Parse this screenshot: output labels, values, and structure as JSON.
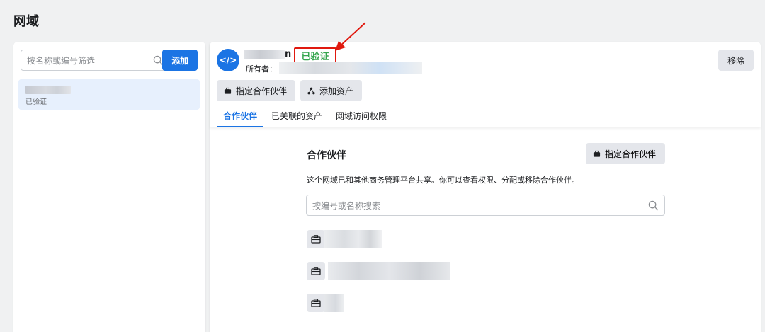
{
  "page": {
    "title": "网域"
  },
  "left": {
    "filter_placeholder": "按名称或编号筛选",
    "add_label": "添加",
    "items": [
      {
        "status": "已验证"
      }
    ]
  },
  "detail": {
    "domain_suffix": "n",
    "verified_label": "已验证",
    "owner_label": "所有者：",
    "remove_label": "移除",
    "assign_partner_label": "指定合作伙伴",
    "add_asset_label": "添加资产",
    "tabs": [
      "合作伙伴",
      "已关联的资产",
      "网域访问权限"
    ],
    "active_tab": 0
  },
  "partners": {
    "title": "合作伙伴",
    "assign_label": "指定合作伙伴",
    "description": "这个网域已和其他商务管理平台共享。你可以查看权限、分配或移除合作伙伴。",
    "search_placeholder": "按编号或名称搜索",
    "rows_count_visible": 3
  },
  "colors": {
    "accent": "#1b74e4",
    "verified_green": "#36a64f",
    "annotation_red": "#e0190f"
  }
}
